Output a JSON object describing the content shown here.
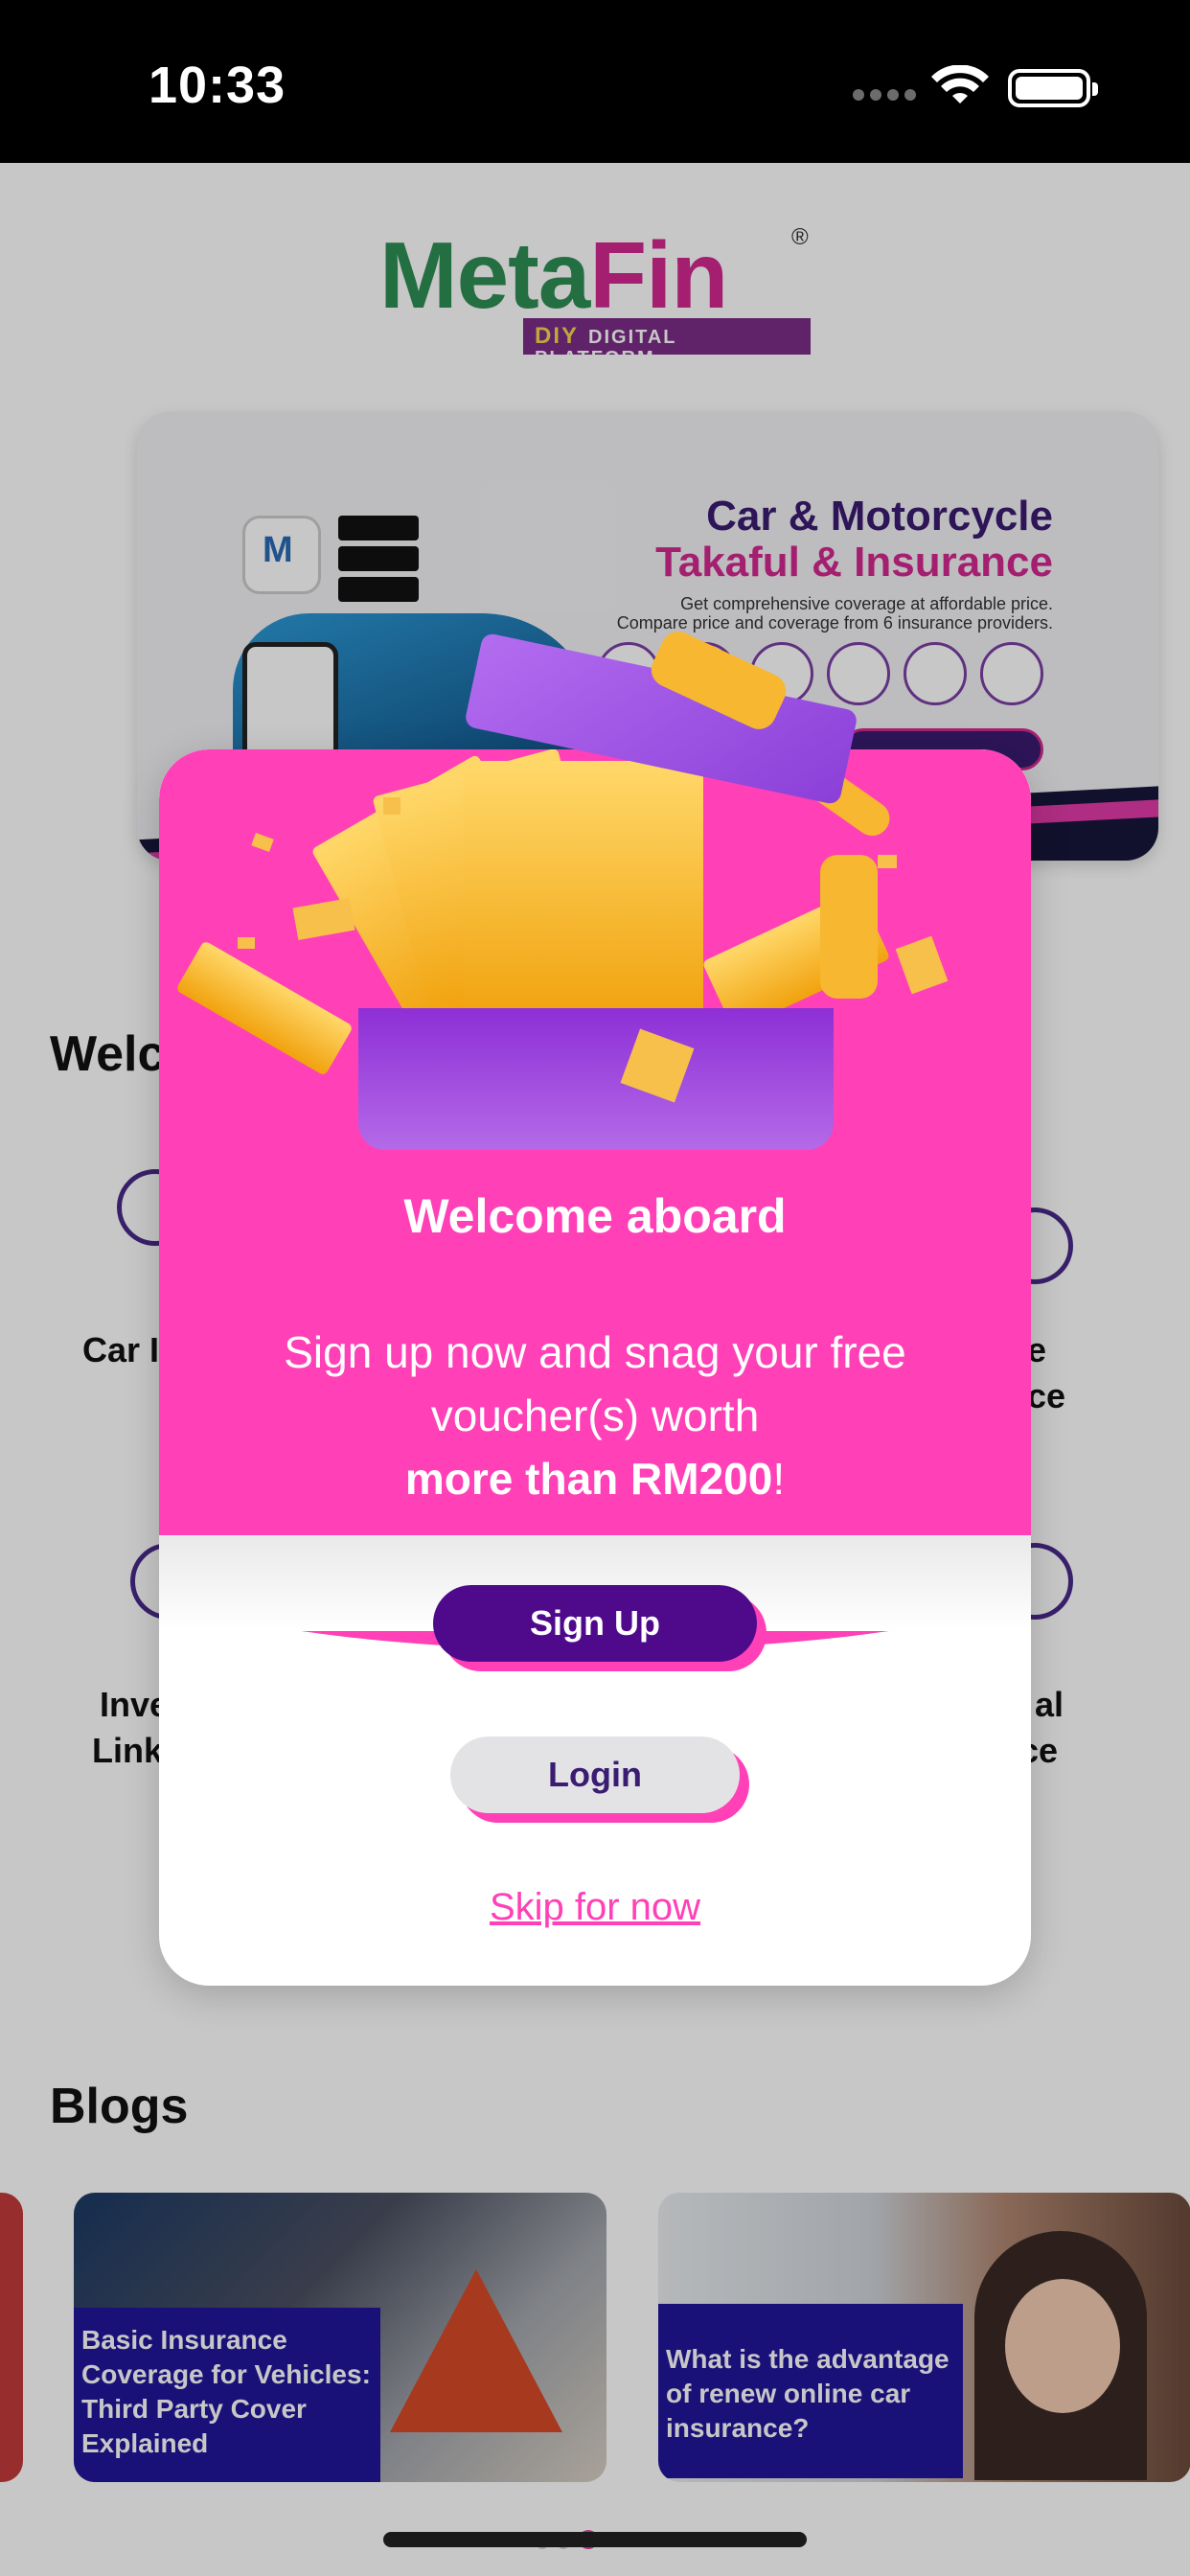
{
  "status_bar": {
    "time": "10:33"
  },
  "header": {
    "logo_text_meta": "Meta",
    "logo_text_fin": "Fin",
    "logo_registered": "®",
    "logo_tag_diy": "DIY",
    "logo_tag_platform": "DIGITAL PLATFORM"
  },
  "banner": {
    "title_line1": "Car & Motorcycle",
    "title_line2": "Takaful & Insurance",
    "subtitle_line1": "Get comprehensive coverage at affordable price.",
    "subtitle_line2": "Compare price and coverage from 6 insurance providers."
  },
  "welcome_section": {
    "heading": "Welco",
    "cat_left_1": "Car In",
    "cat_right_1a": "e",
    "cat_right_1b": "ce",
    "cat_left_2a": "Inve",
    "cat_left_2b": "Link",
    "cat_right_2a": "al",
    "cat_right_2b": "ce"
  },
  "blogs": {
    "heading": "Blogs",
    "cards": [
      {
        "caption": "Basic Insurance Coverage for Vehicles: Third Party Cover Explained"
      },
      {
        "caption": "What is the advantage of renew online car insurance?"
      }
    ]
  },
  "modal": {
    "title": "Welcome aboard",
    "body_line1": "Sign up now and snag your free",
    "body_line2": "voucher(s) worth",
    "body_bold": "more than RM200",
    "body_end": "!",
    "signup_label": "Sign Up",
    "login_label": "Login",
    "skip_label": "Skip for now"
  },
  "colors": {
    "modal_pink": "#ff40b6",
    "brand_purple": "#4f0a8c",
    "login_grey": "#e3e3e6",
    "blog_caption_bg": "#22179a"
  },
  "icons": [
    "wifi-icon",
    "battery-icon",
    "gift-box-icon"
  ]
}
